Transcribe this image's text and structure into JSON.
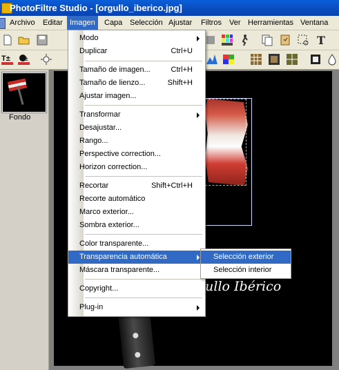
{
  "window": {
    "title": "PhotoFiltre Studio - [orgullo_iberico.jpg]"
  },
  "menubar": {
    "items": [
      "Archivo",
      "Editar",
      "Imagen",
      "Capa",
      "Selección",
      "Ajustar",
      "Filtros",
      "Ver",
      "Herramientas",
      "Ventana"
    ],
    "active": "Imagen"
  },
  "layers": {
    "items": [
      {
        "label": "Fondo"
      }
    ]
  },
  "canvas": {
    "caption": "gullo Ibérico"
  },
  "imagen_menu": {
    "items": [
      {
        "label": "Modo",
        "shortcut": "",
        "submenu": true
      },
      {
        "label": "Duplicar",
        "shortcut": "Ctrl+U"
      },
      {
        "label": "Tamaño de imagen...",
        "shortcut": "Ctrl+H"
      },
      {
        "label": "Tamaño de lienzo...",
        "shortcut": "Shift+H"
      },
      {
        "label": "Ajustar imagen...",
        "shortcut": ""
      },
      {
        "label": "Transformar",
        "shortcut": "",
        "submenu": true
      },
      {
        "label": "Desajustar...",
        "shortcut": ""
      },
      {
        "label": "Rango...",
        "shortcut": ""
      },
      {
        "label": "Perspective correction...",
        "shortcut": ""
      },
      {
        "label": "Horizon correction...",
        "shortcut": ""
      },
      {
        "label": "Recortar",
        "shortcut": "Shift+Ctrl+H"
      },
      {
        "label": "Recorte automático",
        "shortcut": ""
      },
      {
        "label": "Marco exterior...",
        "shortcut": ""
      },
      {
        "label": "Sombra exterior...",
        "shortcut": ""
      },
      {
        "label": "Color transparente...",
        "shortcut": ""
      },
      {
        "label": "Transparencia automática",
        "shortcut": "",
        "submenu": true,
        "highlighted": true
      },
      {
        "label": "Máscara transparente...",
        "shortcut": ""
      },
      {
        "label": "Copyright...",
        "shortcut": ""
      },
      {
        "label": "Plug-in",
        "shortcut": "",
        "submenu": true
      }
    ]
  },
  "transparency_submenu": {
    "items": [
      {
        "label": "Selección exterior",
        "highlighted": true
      },
      {
        "label": "Selección interior"
      }
    ]
  },
  "toolbar": {
    "tb1_icons": [
      "new-icon",
      "open-icon",
      "save-icon",
      "palette-icon",
      "runner-icon",
      "copy-icon",
      "paste-icon",
      "select-icon",
      "text-icon"
    ],
    "tb2_icons": [
      "text-size-icon",
      "contrast-icon",
      "brightness-icon",
      "levels-icon",
      "colors-icon",
      "grid-icon",
      "frame-icon",
      "film-icon",
      "drop-icon"
    ]
  },
  "colors": {
    "accent": "#316ac5",
    "titlebar": "#0b4fc4",
    "menu_bg": "#ffffff",
    "canvas_bg": "#000000"
  }
}
